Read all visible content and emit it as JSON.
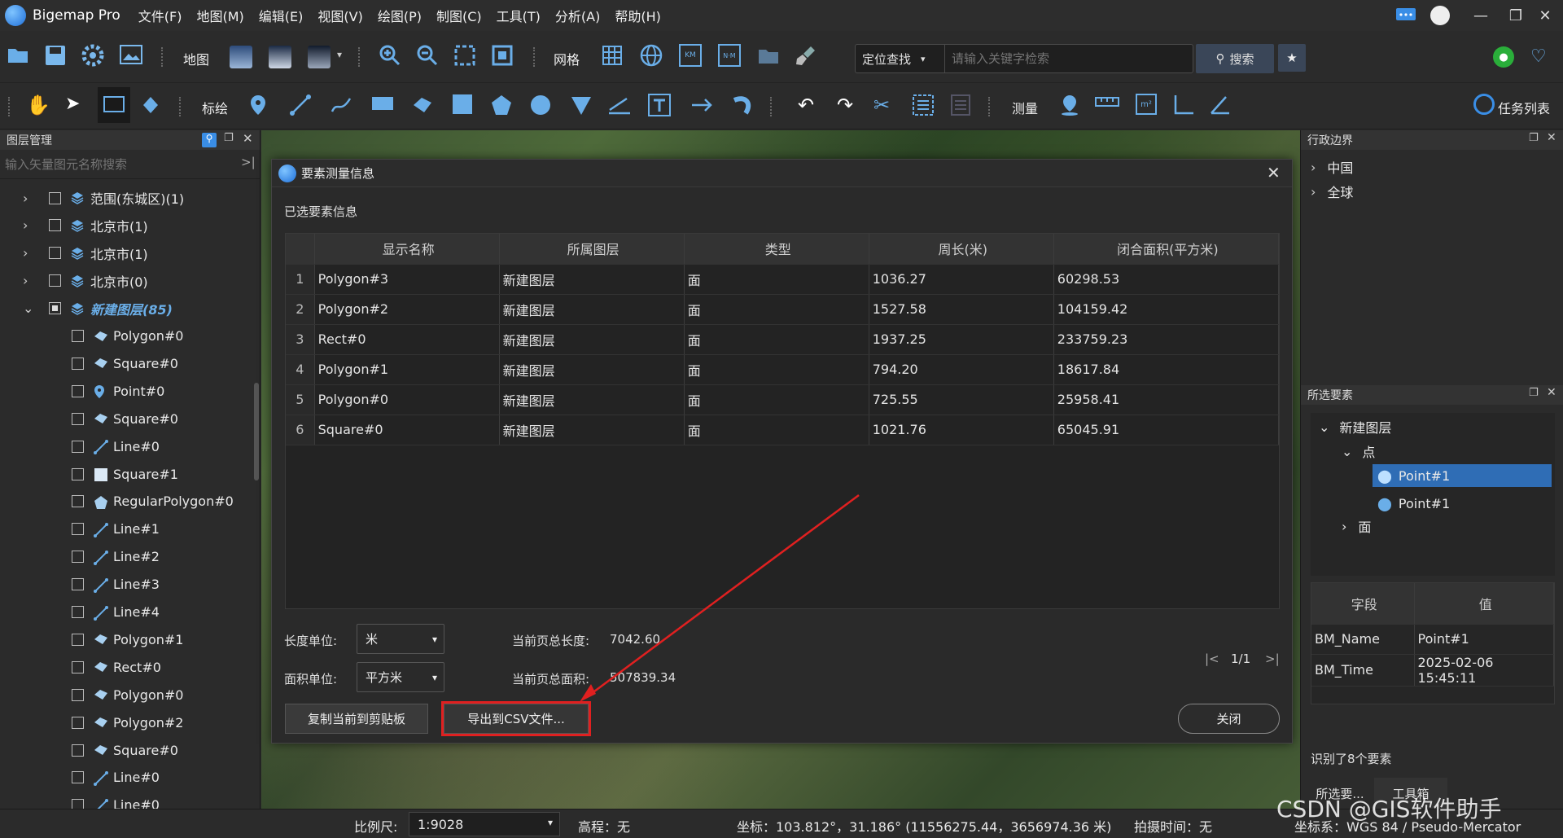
{
  "app": {
    "title": "Bigemap Pro"
  },
  "menu": [
    "文件(F)",
    "地图(M)",
    "编辑(E)",
    "视图(V)",
    "绘图(P)",
    "制图(C)",
    "工具(T)",
    "分析(A)",
    "帮助(H)"
  ],
  "toolbar": {
    "map_label": "地图",
    "grid_label": "网格",
    "locate_label": "定位查找",
    "search_placeholder": "请输入关键字检索",
    "search_btn": "搜索",
    "mark_label": "标绘",
    "measure_label": "测量",
    "tasklist_label": "任务列表",
    "km_label": "KM",
    "nm_label": "N·M"
  },
  "layers": {
    "title": "图层管理",
    "search_placeholder": "输入矢量图元名称搜索",
    "items": [
      {
        "label": "范围(东城区)(1)",
        "icon": "layers-icon"
      },
      {
        "label": "北京市(1)",
        "icon": "layers-icon"
      },
      {
        "label": "北京市(1)",
        "icon": "layers-icon"
      },
      {
        "label": "北京市(0)",
        "icon": "layers-icon"
      },
      {
        "label": "新建图层(85)",
        "icon": "layers-icon"
      },
      {
        "label": "Polygon#0",
        "icon": "polygon-icon"
      },
      {
        "label": "Square#0",
        "icon": "polygon-icon"
      },
      {
        "label": "Point#0",
        "icon": "pin-icon"
      },
      {
        "label": "Square#0",
        "icon": "polygon-icon"
      },
      {
        "label": "Line#0",
        "icon": "line-icon"
      },
      {
        "label": "Square#1",
        "icon": "square-icon"
      },
      {
        "label": "RegularPolygon#0",
        "icon": "pentagon-icon"
      },
      {
        "label": "Line#1",
        "icon": "line-icon"
      },
      {
        "label": "Line#2",
        "icon": "line-icon"
      },
      {
        "label": "Line#3",
        "icon": "line-icon"
      },
      {
        "label": "Line#4",
        "icon": "line-icon"
      },
      {
        "label": "Polygon#1",
        "icon": "polygon-icon"
      },
      {
        "label": "Rect#0",
        "icon": "polygon-icon"
      },
      {
        "label": "Polygon#0",
        "icon": "polygon-icon"
      },
      {
        "label": "Polygon#2",
        "icon": "polygon-icon"
      },
      {
        "label": "Square#0",
        "icon": "polygon-icon"
      },
      {
        "label": "Line#0",
        "icon": "line-icon"
      },
      {
        "label": "Line#0",
        "icon": "line-icon"
      }
    ]
  },
  "dialog": {
    "title": "要素测量信息",
    "section": "已选要素信息",
    "columns": [
      "显示名称",
      "所属图层",
      "类型",
      "周长(米)",
      "闭合面积(平方米)"
    ],
    "rows": [
      [
        "1",
        "Polygon#3",
        "新建图层",
        "面",
        "1036.27",
        "60298.53"
      ],
      [
        "2",
        "Polygon#2",
        "新建图层",
        "面",
        "1527.58",
        "104159.42"
      ],
      [
        "3",
        "Rect#0",
        "新建图层",
        "面",
        "1937.25",
        "233759.23"
      ],
      [
        "4",
        "Polygon#1",
        "新建图层",
        "面",
        "794.20",
        "18617.84"
      ],
      [
        "5",
        "Polygon#0",
        "新建图层",
        "面",
        "725.55",
        "25958.41"
      ],
      [
        "6",
        "Square#0",
        "新建图层",
        "面",
        "1021.76",
        "65045.91"
      ]
    ],
    "length_unit_label": "长度单位:",
    "length_unit": "米",
    "area_unit_label": "面积单位:",
    "area_unit": "平方米",
    "total_length_label": "当前页总长度:",
    "total_length": "7042.60",
    "total_area_label": "当前页总面积:",
    "total_area": "507839.34",
    "page": "1/1",
    "copy_btn": "复制当前到剪贴板",
    "export_btn": "导出到CSV文件...",
    "close_btn": "关闭"
  },
  "admin": {
    "title": "行政边界",
    "items": [
      "中国",
      "全球"
    ]
  },
  "selected": {
    "title": "所选要素",
    "layer": "新建图层",
    "point_group": "点",
    "points": [
      "Point#1",
      "Point#1"
    ],
    "face_group": "面",
    "field_header": "字段",
    "value_header": "值",
    "fields": [
      [
        "BM_Name",
        "Point#1"
      ],
      [
        "BM_Time",
        "2025-02-06 15:45:11"
      ]
    ],
    "count_text": "识别了8个要素",
    "tab1": "所选要...",
    "tab2": "工具箱"
  },
  "status": {
    "scale_label": "比例尺:",
    "scale": "1:9028",
    "elev": "高程：无",
    "coord": "坐标：103.812°，31.186°   (11556275.44，3656974.36 米)",
    "shot": "拍摄时间：无",
    "crs": "坐标系：WGS 84 / Pseudo-Mercator"
  },
  "watermark": "CSDN @GIS软件助手",
  "colors": {
    "accent": "#1e78d2",
    "highlight": "#e02020",
    "selected_row": "#2f6db5"
  }
}
